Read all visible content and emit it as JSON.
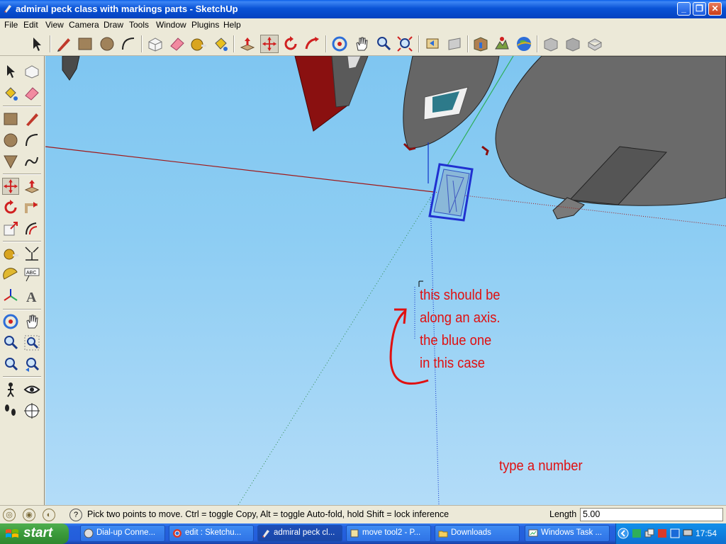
{
  "window": {
    "title": "admiral peck class with markings parts - SketchUp",
    "controls": [
      "minimize",
      "maximize",
      "close"
    ]
  },
  "menu": [
    "File",
    "Edit",
    "View",
    "Camera",
    "Draw",
    "Tools",
    "Window",
    "Plugins",
    "Help"
  ],
  "toolbar": {
    "icons": [
      "select-icon",
      "pencil-icon",
      "rectangle-icon",
      "circle-icon",
      "arc-icon",
      "make-component-icon",
      "eraser-icon",
      "tape-measure-icon",
      "paint-bucket-icon",
      "push-pull-icon",
      "move-icon",
      "rotate-icon",
      "follow-me-icon",
      "orbit-icon",
      "pan-icon",
      "zoom-icon",
      "zoom-extents-icon",
      "previous-view-icon",
      "next-view-icon",
      "add-location-icon",
      "toggle-terrain-icon",
      "google-earth-icon",
      "get-models-icon",
      "share-model-icon",
      "share-component-icon"
    ]
  },
  "left_tools": {
    "icons": [
      "select-icon",
      "make-component-icon",
      "paint-bucket-icon",
      "eraser-icon",
      "rectangle-icon",
      "line-icon",
      "circle-icon",
      "arc-icon",
      "polygon-icon",
      "freehand-icon",
      "move-icon",
      "push-pull-icon",
      "rotate-icon",
      "follow-me-icon",
      "scale-icon",
      "offset-icon",
      "tape-measure-icon",
      "dimension-icon",
      "protractor-icon",
      "text-icon",
      "axes-icon",
      "3d-text-icon",
      "orbit-icon",
      "pan-icon",
      "zoom-icon",
      "zoom-window-icon",
      "zoom-extents-icon",
      "previous-view-icon",
      "position-camera-icon",
      "look-around-icon",
      "walk-icon",
      "section-plane-icon"
    ]
  },
  "annotation": {
    "lines": [
      "this should be",
      "along an axis.",
      "the blue one",
      "in this case"
    ],
    "hint": "type a number"
  },
  "status": {
    "message": "Pick two points to move.  Ctrl = toggle Copy, Alt = toggle Auto-fold, hold Shift = lock inference",
    "length_label": "Length",
    "length_value": "5.00"
  },
  "taskbar": {
    "start_label": "start",
    "tasks": [
      "Dial-up Conne...",
      "edit : Sketchu...",
      "admiral peck cl...",
      "move tool2 - P...",
      "Downloads",
      "Windows Task ..."
    ],
    "clock": "17:54"
  },
  "colors": {
    "sky": "#8dcdf3",
    "annotation": "#e01010",
    "red_axis": "#a01818",
    "green_axis": "#2fae5a",
    "blue_axis": "#1030c8",
    "taskbar": "#245ddb"
  }
}
